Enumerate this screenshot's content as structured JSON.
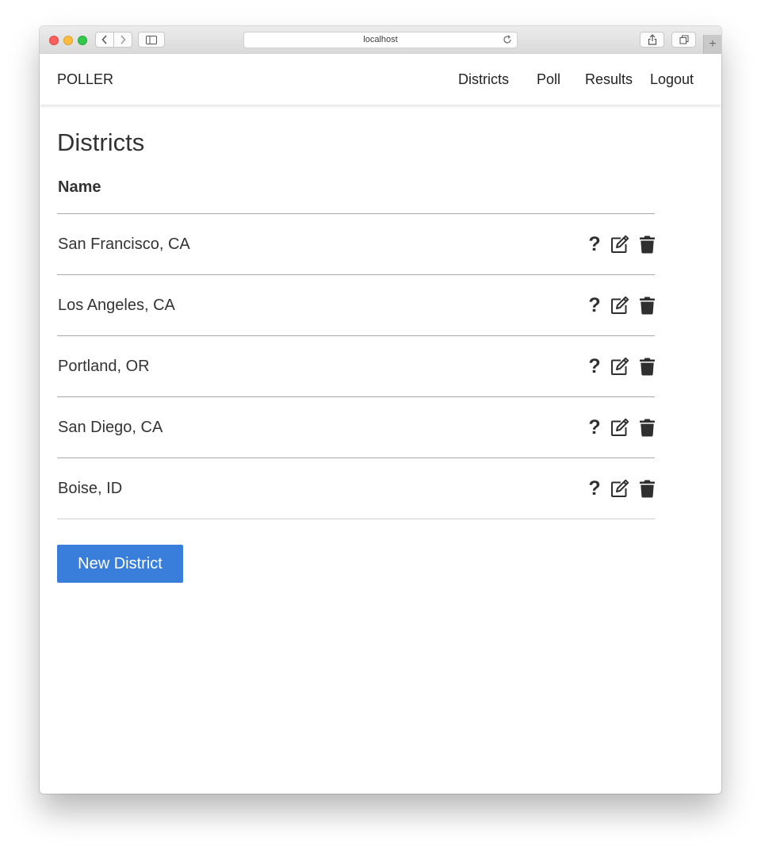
{
  "browser": {
    "address": "localhost"
  },
  "navbar": {
    "brand": "POLLER",
    "links": {
      "districts": "Districts",
      "poll": "Poll",
      "results": "Results",
      "logout": "Logout"
    }
  },
  "page": {
    "title": "Districts",
    "column_header": "Name",
    "districts": [
      {
        "name": "San Francisco, CA",
        "view_glyph": "?"
      },
      {
        "name": "Los Angeles, CA",
        "view_glyph": "?"
      },
      {
        "name": "Portland, OR",
        "view_glyph": "?"
      },
      {
        "name": "San Diego, CA",
        "view_glyph": "?"
      },
      {
        "name": "Boise, ID",
        "view_glyph": "?"
      }
    ],
    "new_button": "New District"
  },
  "icons": {
    "view": "question-icon",
    "edit": "edit-icon",
    "delete": "trash-icon"
  },
  "colors": {
    "accent": "#3a7edb",
    "text": "#333333"
  }
}
